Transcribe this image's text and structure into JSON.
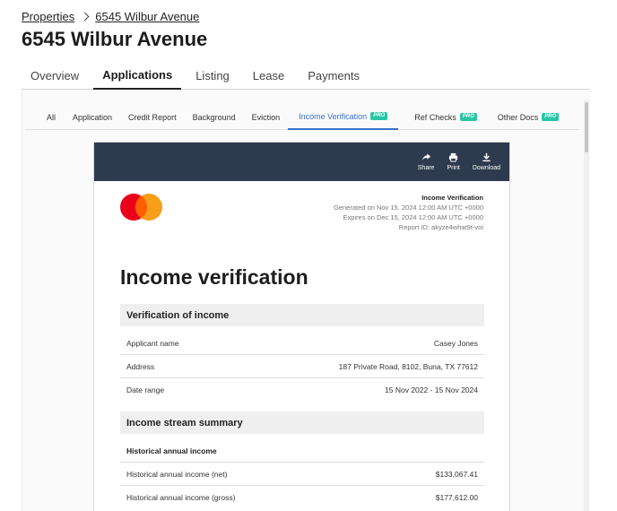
{
  "breadcrumb": {
    "root": "Properties",
    "current": "6545 Wilbur Avenue"
  },
  "page_title": "6545 Wilbur Avenue",
  "main_tabs": [
    {
      "label": "Overview"
    },
    {
      "label": "Applications",
      "active": true
    },
    {
      "label": "Listing"
    },
    {
      "label": "Lease"
    },
    {
      "label": "Payments"
    }
  ],
  "sub_tabs": [
    {
      "label": "All"
    },
    {
      "label": "Application"
    },
    {
      "label": "Credit Report"
    },
    {
      "label": "Background"
    },
    {
      "label": "Eviction"
    },
    {
      "label": "Income Verification",
      "pro": "PRO",
      "active": true
    },
    {
      "label": "Ref Checks",
      "pro": "PRO"
    },
    {
      "label": "Other Docs",
      "pro": "PRO"
    }
  ],
  "toolbar": {
    "share": "Share",
    "print": "Print",
    "download": "Download"
  },
  "meta": {
    "title": "Income Verification",
    "generated": "Generated on Nov 15, 2024 12:00 AM UTC +0000",
    "expires": "Expires on Dec 15, 2024 12:00 AM UTC +0000",
    "report_id": "Report ID: akyze4what9t-voi"
  },
  "report": {
    "heading": "Income verification",
    "verification_section": {
      "title": "Verification of income",
      "rows": [
        {
          "label": "Applicant name",
          "value": "Casey Jones"
        },
        {
          "label": "Address",
          "value": "187 Private Road, 8102, Buna, TX 77612"
        },
        {
          "label": "Date range",
          "value": "15 Nov 2022 - 15 Nov 2024"
        }
      ]
    },
    "income_section": {
      "title": "Income stream summary",
      "subheading": "Historical annual income",
      "rows": [
        {
          "label": "Historical annual income (net)",
          "value": "$133,067.41"
        },
        {
          "label": "Historical annual income (gross)",
          "value": "$177,612.00"
        }
      ]
    }
  },
  "colors": {
    "toolbar_bg": "#2e3a4d",
    "active_sub_tab": "#3b6fc8",
    "pro_badge": "#26c6a6",
    "logo_red": "#eb001b",
    "logo_orange": "#f79e1b"
  },
  "icons": [
    "chevron-right-icon",
    "share-icon",
    "print-icon",
    "download-icon",
    "mastercard-logo"
  ]
}
